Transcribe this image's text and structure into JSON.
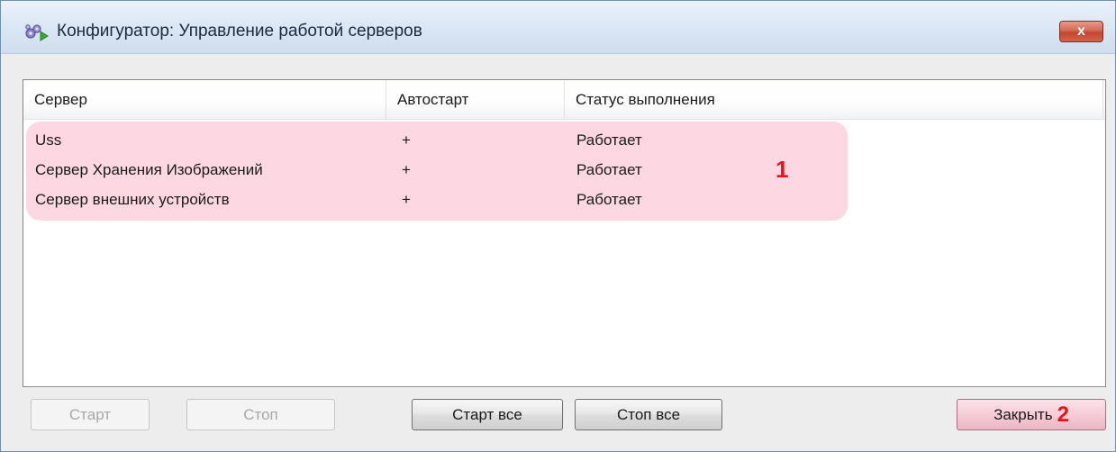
{
  "window": {
    "title": "Конфигуратор: Управление работой серверов",
    "close_glyph": "x"
  },
  "table": {
    "columns": [
      "Сервер",
      "Автостарт",
      "Статус выполнения"
    ],
    "rows": [
      {
        "server": "Uss",
        "autostart": "+",
        "status": "Работает"
      },
      {
        "server": "Сервер Хранения Изображений",
        "autostart": "+",
        "status": "Работает"
      },
      {
        "server": "Сервер внешних устройств",
        "autostart": "+",
        "status": "Работает"
      }
    ]
  },
  "annotations": {
    "marker_1": "1",
    "marker_2": "2",
    "highlight_color": "#fdd8e2",
    "marker_color": "#e8131a"
  },
  "buttons": {
    "start": "Старт",
    "stop": "Стоп",
    "start_all": "Старт все",
    "stop_all": "Стоп все",
    "close": "Закрыть"
  },
  "icons": {
    "app": "gears-icon",
    "close": "close-icon"
  }
}
